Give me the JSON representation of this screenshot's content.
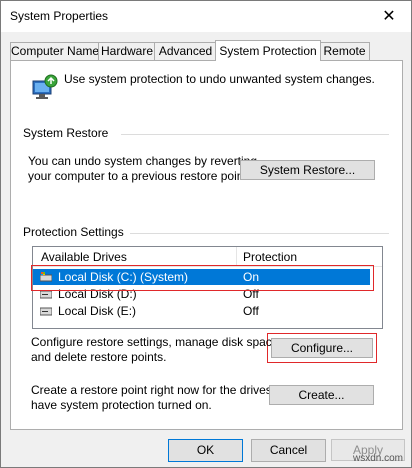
{
  "window": {
    "title": "System Properties"
  },
  "tabs": [
    {
      "label": "Computer Name"
    },
    {
      "label": "Hardware"
    },
    {
      "label": "Advanced"
    },
    {
      "label": "System Protection",
      "active": true
    },
    {
      "label": "Remote"
    }
  ],
  "intro": {
    "text": "Use system protection to undo unwanted system changes."
  },
  "system_restore": {
    "heading": "System Restore",
    "description_line1": "You can undo system changes by reverting",
    "description_line2": "your computer to a previous restore point.",
    "button_label": "System Restore..."
  },
  "protection": {
    "heading": "Protection Settings",
    "columns": [
      "Available Drives",
      "Protection"
    ],
    "drives": [
      {
        "name": "Local Disk (C:) (System)",
        "protection": "On",
        "selected": true
      },
      {
        "name": "Local Disk (D:)",
        "protection": "Off"
      },
      {
        "name": "Local Disk (E:)",
        "protection": "Off"
      }
    ],
    "configure_line1": "Configure restore settings, manage disk space,",
    "configure_line2": "and delete restore points.",
    "configure_button": "Configure...",
    "create_line1": "Create a restore point right now for the drives that",
    "create_line2": "have system protection turned on.",
    "create_button": "Create..."
  },
  "footer": {
    "ok": "OK",
    "cancel": "Cancel",
    "apply": "Apply"
  },
  "watermark": "wsxdn.com",
  "colors": {
    "selection": "#0078d7",
    "highlight_box": "#e0282a"
  }
}
